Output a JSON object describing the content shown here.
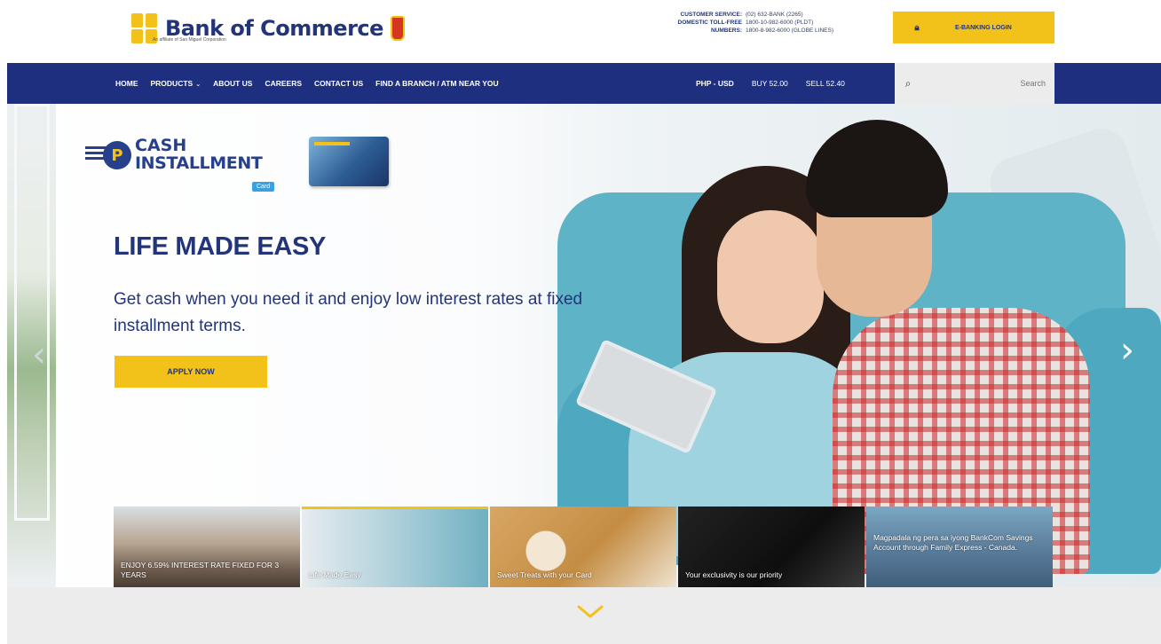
{
  "header": {
    "brand_name": "Bank of Commerce",
    "brand_tagline": "An affiliate of San Miguel Corporation",
    "customer_service": [
      {
        "label": "CUSTOMER SERVICE:",
        "value": "(02) 632-BANK (2265)"
      },
      {
        "label": "DOMESTIC TOLL-FREE",
        "value": "1800-10-982-6000 (PLDT)"
      },
      {
        "label": "NUMBERS:",
        "value": "1800-8-982-6000 (GLOBE LINES)"
      }
    ],
    "ebanking_label": "E-BANKING LOGIN"
  },
  "nav": {
    "items": [
      {
        "label": "HOME",
        "has_dropdown": false
      },
      {
        "label": "PRODUCTS",
        "has_dropdown": true
      },
      {
        "label": "ABOUT US",
        "has_dropdown": false
      },
      {
        "label": "CAREERS",
        "has_dropdown": false
      },
      {
        "label": "CONTACT US",
        "has_dropdown": false
      },
      {
        "label": "FIND A BRANCH / ATM NEAR YOU",
        "has_dropdown": false
      }
    ],
    "dropdown_caret": "⌄",
    "fx_pair": "PHP - USD",
    "fx_buy": "BUY 52.00",
    "fx_sell": "SELL 52.40",
    "search_placeholder": "Search"
  },
  "hero": {
    "badge_line1": "CASH",
    "badge_line2": "INSTALLMENT",
    "badge_tag": "Card",
    "badge_letter": "P",
    "title": "LIFE MADE EASY",
    "description": "Get cash when you need it and enjoy low interest rates at fixed installment terms.",
    "cta_label": "APPLY NOW"
  },
  "slides": [
    {
      "caption": "ENJOY 6.59% INTEREST RATE FIXED FOR 3 YEARS",
      "active": false
    },
    {
      "caption": "Life Made Easy",
      "active": true
    },
    {
      "caption": "Sweet Treats with your Card",
      "active": false
    },
    {
      "caption": "Your exclusivity is our priority",
      "active": false
    },
    {
      "caption": "Magpadala ng pera sa iyong BankCom Savings Account through Family Express - Canada.",
      "active": false
    }
  ],
  "colors": {
    "navy": "#1f2f80",
    "brand_blue": "#22347a",
    "accent_yellow": "#f2c21b",
    "band_gray": "#ececec"
  },
  "icons": {
    "lock": "lock-icon",
    "search": "search-icon",
    "prev": "chevron-left-icon",
    "next": "chevron-right-icon",
    "scroll": "chevron-down-icon"
  }
}
